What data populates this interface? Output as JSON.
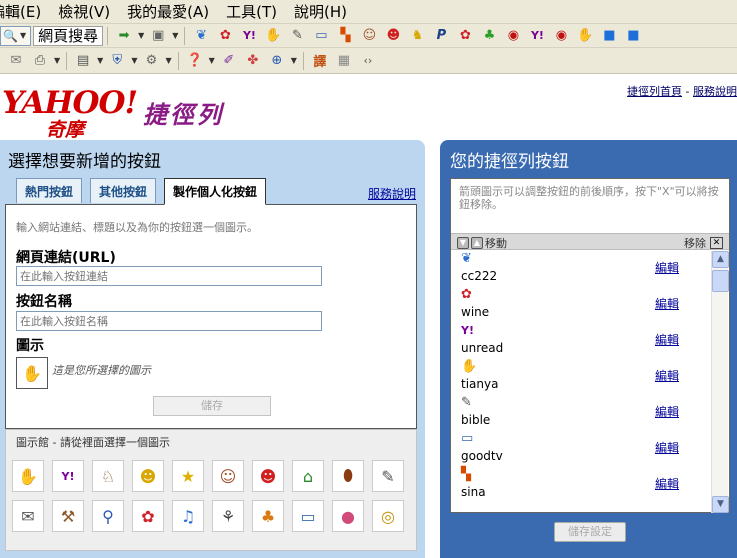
{
  "menu": [
    "編輯(E)",
    "檢視(V)",
    "我的最愛(A)",
    "工具(T)",
    "說明(H)"
  ],
  "toolbar": {
    "search_label": "網頁搜尋",
    "icons": [
      "search-icon",
      "highlight-icon",
      "bookmark-icon",
      "butterfly-icon",
      "rose-icon",
      "yahoo-mail-icon",
      "hand-icon",
      "book-icon",
      "computer-icon",
      "sina-icon",
      "avatar-girl-icon",
      "cartoon-boy-icon",
      "cat-icon",
      "paypal-icon",
      "rose-icon",
      "frog-icon",
      "camera-icon",
      "yahoo-icon",
      "camera-icon",
      "hand-icon",
      "chat-icon",
      "chat-icon"
    ]
  },
  "header": {
    "logo_text": "YAHOO!",
    "logo_sub": "奇摩",
    "title": "捷徑列",
    "links": [
      "捷徑列首頁",
      "服務說明"
    ],
    "link_sep": " - "
  },
  "left_panel": {
    "title": "選擇想要新增的按鈕",
    "tabs": [
      "熱門按鈕",
      "其他按鈕",
      "製作個人化按鈕"
    ],
    "service_link": "服務說明",
    "hint": "輸入網站連結、標題以及為你的按鈕選一個圖示。",
    "url_label": "網頁連結(URL)",
    "url_placeholder": "在此輸入按鈕連結",
    "name_label": "按鈕名稱",
    "name_placeholder": "在此輸入按鈕名稱",
    "icon_label": "圖示",
    "icon_note": "這是您所選擇的圖示",
    "save_label": "儲存",
    "gallery_title": "圖示館 - 請從裡面選擇一個圖示"
  },
  "right_panel": {
    "title": "您的捷徑列按鈕",
    "hint": "箭頭圖示可以調整按鈕的前後順序，按下\"X\"可以將按鈕移除。",
    "move_label": "移動",
    "remove_label": "移除",
    "edit_label": "編輯",
    "items": [
      {
        "name": "cc222",
        "icon": "butterfly-icon"
      },
      {
        "name": "wine",
        "icon": "rose-icon"
      },
      {
        "name": "unread",
        "icon": "yahoo-mail-icon"
      },
      {
        "name": "tianya",
        "icon": "hand-icon"
      },
      {
        "name": "bible",
        "icon": "book-icon"
      },
      {
        "name": "goodtv",
        "icon": "computer-icon"
      },
      {
        "name": "sina",
        "icon": "sina-icon"
      }
    ],
    "save_label": "儲存設定"
  }
}
